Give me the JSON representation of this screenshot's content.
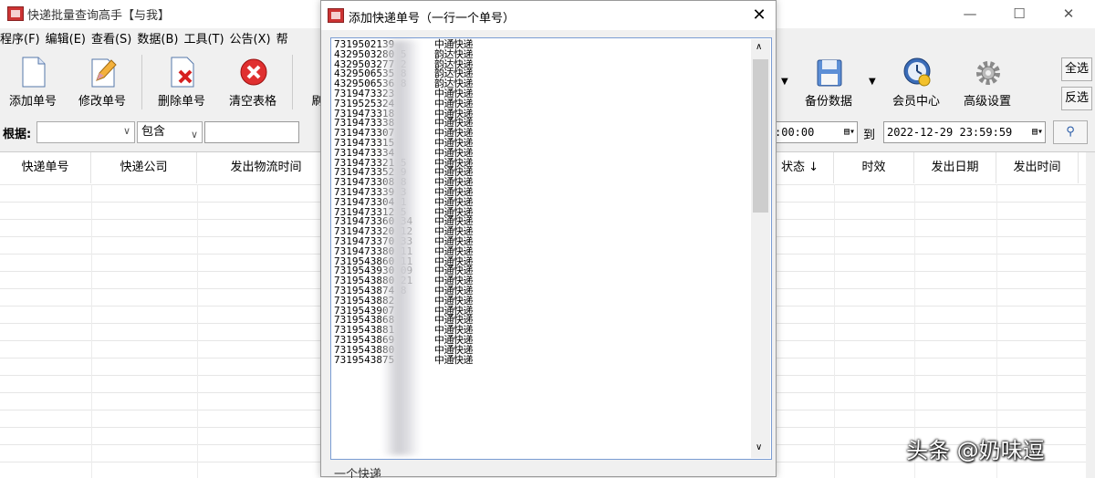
{
  "main_window": {
    "title": "快递批量查询高手【与我】",
    "controls": {
      "minimize": "—",
      "maximize": "☐",
      "close": "✕"
    },
    "menu": [
      "程序(F)",
      "编辑(E)",
      "查看(S)",
      "数据(B)",
      "工具(T)",
      "公告(X)",
      "帮"
    ],
    "toolbar": {
      "add": "添加单号",
      "edit": "修改单号",
      "delete": "删除单号",
      "clear": "清空表格",
      "refresh": "刷",
      "backup": "备份数据",
      "member": "会员中心",
      "advanced": "高级设置",
      "select_all": "全选",
      "invert": "反选"
    },
    "filter": {
      "label": "根据:",
      "field_value": "",
      "match_value": "包含",
      "search_value": "",
      "date_from_visible": ":00:00 ",
      "to_label": "到",
      "date_to": "2022-12-29 23:59:59"
    },
    "grid_headers_left": [
      "快递单号",
      "快递公司",
      "发出物流时间"
    ],
    "grid_headers_right": [
      "状态 ↓",
      "时效",
      "发出日期",
      "发出时间"
    ]
  },
  "dialog": {
    "title": "添加快递单号（一行一个单号）",
    "close": "✕",
    "footer_partial": "一个快递",
    "lines": [
      {
        "no": "7319502139",
        "company": "中通快递"
      },
      {
        "no": "4329503280   5",
        "company": "韵达快递"
      },
      {
        "no": "4329503277   2",
        "company": "韵达快递"
      },
      {
        "no": "4329506535   8",
        "company": "韵达快递"
      },
      {
        "no": "4329506536   8",
        "company": "韵达快递"
      },
      {
        "no": "7319473323",
        "company": "中通快递"
      },
      {
        "no": "7319525324",
        "company": "中通快递"
      },
      {
        "no": "7319473318",
        "company": "中通快递"
      },
      {
        "no": "7319473338",
        "company": "中通快递"
      },
      {
        "no": "7319473307",
        "company": "中通快递"
      },
      {
        "no": "7319473315",
        "company": "中通快递"
      },
      {
        "no": "7319473334",
        "company": "中通快递"
      },
      {
        "no": "7319473321   5",
        "company": "中通快递"
      },
      {
        "no": "7319473352   9",
        "company": "中通快递"
      },
      {
        "no": "7319473308   8",
        "company": "中通快递"
      },
      {
        "no": "7319473339   3",
        "company": "中通快递"
      },
      {
        "no": "7319473304   1",
        "company": "中通快递"
      },
      {
        "no": "7319473312   5",
        "company": "中通快递"
      },
      {
        "no": "7319473360  34",
        "company": "中通快递"
      },
      {
        "no": "7319473320  12",
        "company": "中通快递"
      },
      {
        "no": "7319473370  33",
        "company": "中通快递"
      },
      {
        "no": "7319473380  11",
        "company": "中通快递"
      },
      {
        "no": "7319543860  11",
        "company": "中通快递"
      },
      {
        "no": "7319543930  09",
        "company": "中通快递"
      },
      {
        "no": "7319543880  21",
        "company": "中通快递"
      },
      {
        "no": "7319543874   8",
        "company": "中通快递"
      },
      {
        "no": "7319543882",
        "company": "中通快递"
      },
      {
        "no": "7319543907",
        "company": "中通快递"
      },
      {
        "no": "7319543868",
        "company": "中通快递"
      },
      {
        "no": "7319543881",
        "company": "中通快递"
      },
      {
        "no": "7319543869",
        "company": "中通快递"
      },
      {
        "no": "7319543880",
        "company": "中通快递"
      },
      {
        "no": "7319543875",
        "company": "中通快递"
      }
    ]
  },
  "watermark": "头条 @奶味逗"
}
